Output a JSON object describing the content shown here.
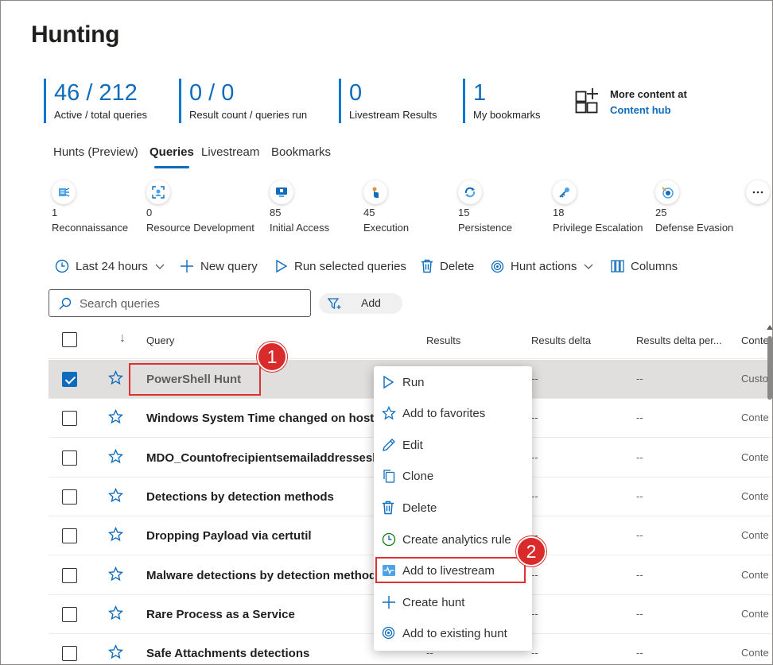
{
  "page": {
    "title": "Hunting"
  },
  "stats": [
    {
      "value": "46 / 212",
      "label": "Active / total queries"
    },
    {
      "value": "0 / 0",
      "label": "Result count / queries run"
    },
    {
      "value": "0",
      "label": "Livestream Results"
    },
    {
      "value": "1",
      "label": "My bookmarks"
    }
  ],
  "content_hub": {
    "line1": "More content at",
    "link": "Content hub",
    "icon": "grid-plus-icon"
  },
  "tabs": [
    {
      "label": "Hunts (Preview)",
      "active": false
    },
    {
      "label": "Queries",
      "active": true
    },
    {
      "label": "Livestream",
      "active": false
    },
    {
      "label": "Bookmarks",
      "active": false
    }
  ],
  "tactics": [
    {
      "count": "1",
      "name": "Reconnaissance",
      "icon": "reconnaissance-icon"
    },
    {
      "count": "0",
      "name": "Resource Development",
      "icon": "resource-development-icon"
    },
    {
      "count": "85",
      "name": "Initial Access",
      "icon": "initial-access-icon"
    },
    {
      "count": "45",
      "name": "Execution",
      "icon": "execution-icon"
    },
    {
      "count": "15",
      "name": "Persistence",
      "icon": "persistence-icon"
    },
    {
      "count": "18",
      "name": "Privilege Escalation",
      "icon": "privilege-escalation-icon"
    },
    {
      "count": "25",
      "name": "Defense Evasion",
      "icon": "defense-evasion-icon"
    }
  ],
  "toolbar": {
    "time_range": "Last 24 hours",
    "new_query": "New query",
    "run_selected": "Run selected queries",
    "delete": "Delete",
    "hunt_actions": "Hunt actions",
    "columns": "Columns"
  },
  "search": {
    "placeholder": "Search queries",
    "value": ""
  },
  "filter": {
    "label": "Add"
  },
  "table": {
    "sort_indicator": "↓",
    "columns": [
      "Query",
      "Results",
      "Results delta",
      "Results delta per...",
      "Conte"
    ],
    "rows": [
      {
        "name": "PowerShell Hunt",
        "checked": true,
        "results": "",
        "delta": "--",
        "delta_pct": "--",
        "content": "Custo"
      },
      {
        "name": "Windows System Time changed on hosts",
        "checked": false,
        "results": "",
        "delta": "--",
        "delta_pct": "--",
        "content": "Conte"
      },
      {
        "name": "MDO_Countofrecipientsemailaddressesby",
        "checked": false,
        "results": "",
        "delta": "--",
        "delta_pct": "--",
        "content": "Conte"
      },
      {
        "name": "Detections by detection methods",
        "checked": false,
        "results": "",
        "delta": "--",
        "delta_pct": "--",
        "content": "Conte"
      },
      {
        "name": "Dropping Payload via certutil",
        "checked": false,
        "results": "",
        "delta": "--",
        "delta_pct": "--",
        "content": "Conte"
      },
      {
        "name": "Malware detections by detection method",
        "checked": false,
        "results": "",
        "delta": "--",
        "delta_pct": "--",
        "content": "Conte"
      },
      {
        "name": "Rare Process as a Service",
        "checked": false,
        "results": "",
        "delta": "--",
        "delta_pct": "--",
        "content": "Conte"
      },
      {
        "name": "Safe Attachments detections",
        "checked": false,
        "results": "--",
        "delta": "--",
        "delta_pct": "--",
        "content": "Conte"
      }
    ]
  },
  "context_menu": {
    "items": [
      {
        "label": "Run",
        "icon": "play-icon"
      },
      {
        "label": "Add to favorites",
        "icon": "star-icon"
      },
      {
        "label": "Edit",
        "icon": "pencil-icon"
      },
      {
        "label": "Clone",
        "icon": "copy-icon"
      },
      {
        "label": "Delete",
        "icon": "trash-icon"
      },
      {
        "label": "Create analytics rule",
        "icon": "analytics-rule-icon"
      },
      {
        "label": "Add to livestream",
        "icon": "livestream-icon"
      },
      {
        "label": "Create hunt",
        "icon": "plus-icon"
      },
      {
        "label": "Add to existing hunt",
        "icon": "hunt-icon"
      }
    ]
  },
  "callouts": [
    {
      "number": "1"
    },
    {
      "number": "2"
    }
  ],
  "colors": {
    "accent": "#0f6cbd",
    "callout": "#d92b2b",
    "selected_row": "#e1dfdd"
  }
}
